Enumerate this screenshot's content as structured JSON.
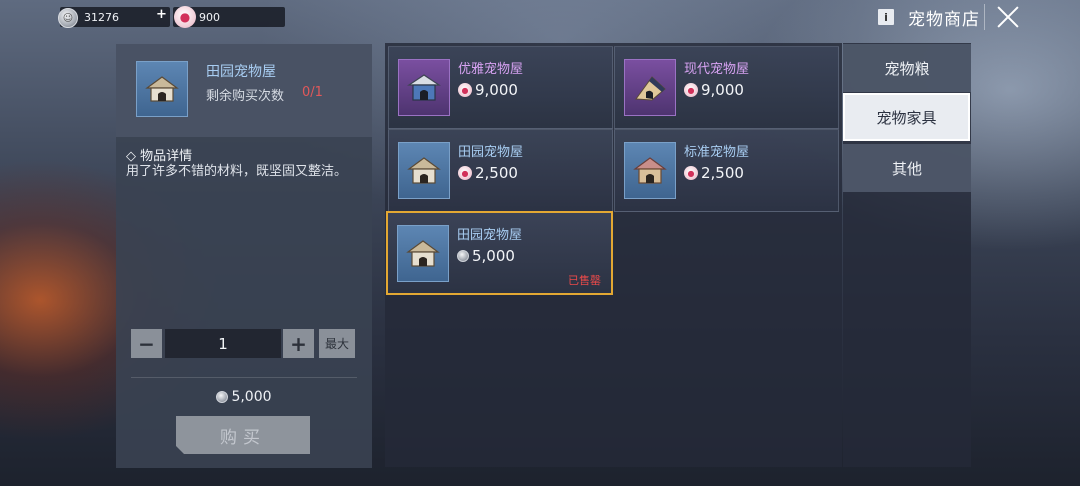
{
  "header": {
    "silver_amount": "31276",
    "paw_amount": "900",
    "plus_label": "+",
    "info_label": "i",
    "title": "宠物商店"
  },
  "detail": {
    "name": "田园宠物屋",
    "remaining_label": "剩余购买次数",
    "remaining_count": "0/1",
    "section_title": "◇ 物品详情",
    "description": "用了许多不错的材料，既坚固又整洁。",
    "quantity": "1",
    "minus_label": "−",
    "plus_label": "+",
    "max_label": "最大",
    "total_price": "5,000",
    "buy_label": "购买"
  },
  "items": [
    {
      "name": "优雅宠物屋",
      "price": "9,000",
      "currency": "paw",
      "rarity": "purple",
      "sold_out": ""
    },
    {
      "name": "现代宠物屋",
      "price": "9,000",
      "currency": "paw",
      "rarity": "purple",
      "sold_out": ""
    },
    {
      "name": "田园宠物屋",
      "price": "2,500",
      "currency": "paw",
      "rarity": "blue",
      "sold_out": ""
    },
    {
      "name": "标准宠物屋",
      "price": "2,500",
      "currency": "paw",
      "rarity": "blue",
      "sold_out": ""
    },
    {
      "name": "田园宠物屋",
      "price": "5,000",
      "currency": "silver",
      "rarity": "blue",
      "sold_out": "已售罄"
    }
  ],
  "tabs": [
    {
      "label": "宠物粮",
      "active": false
    },
    {
      "label": "宠物家具",
      "active": true
    },
    {
      "label": "其他",
      "active": false
    }
  ],
  "colors": {
    "rarity_purple": "#d7a2f2",
    "rarity_blue": "#a8cdf2",
    "sold_out": "#ea4a4a",
    "selected_border": "#e3a833",
    "remaining_count": "#e0585a"
  },
  "icons": {
    "silver_currency": "silver-coin-icon",
    "paw_currency": "paw-icon",
    "close": "close-icon",
    "info": "info-icon"
  }
}
